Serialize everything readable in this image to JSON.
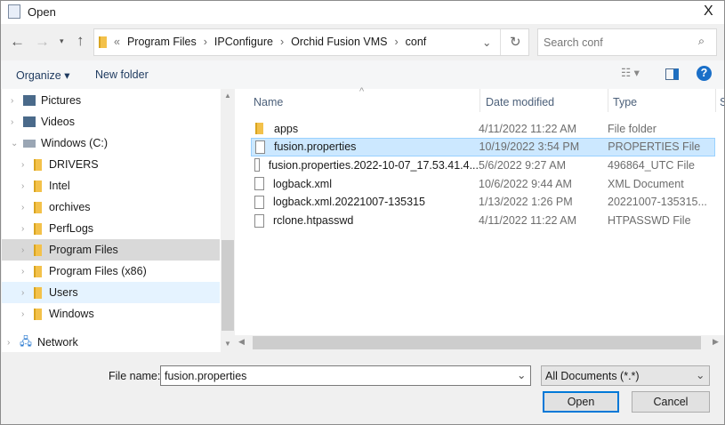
{
  "window": {
    "title": "Open",
    "close": "X"
  },
  "nav": {
    "breadcrumb": [
      "Program Files",
      "IPConfigure",
      "Orchid Fusion VMS",
      "conf"
    ],
    "overflow": "«",
    "search_placeholder": "Search conf"
  },
  "toolbar": {
    "organize": "Organize ▾",
    "new_folder": "New folder",
    "help": "?"
  },
  "sidebar": [
    {
      "label": "Pictures",
      "indent": 1
    },
    {
      "label": "Videos",
      "indent": 1
    },
    {
      "label": "Windows (C:)",
      "indent": 1,
      "expanded": true
    },
    {
      "label": "DRIVERS",
      "indent": 2
    },
    {
      "label": "Intel",
      "indent": 2
    },
    {
      "label": "orchives",
      "indent": 2
    },
    {
      "label": "PerfLogs",
      "indent": 2
    },
    {
      "label": "Program Files",
      "indent": 2,
      "selected": true
    },
    {
      "label": "Program Files (x86)",
      "indent": 2
    },
    {
      "label": "Users",
      "indent": 2,
      "hover": true
    },
    {
      "label": "Windows",
      "indent": 2
    },
    {
      "label": "Network",
      "indent": 0
    }
  ],
  "columns": [
    "Name",
    "Date modified",
    "Type",
    "Size"
  ],
  "files": [
    {
      "name": "apps",
      "date": "4/11/2022 11:22 AM",
      "type": "File folder",
      "folder": true
    },
    {
      "name": "fusion.properties",
      "date": "10/19/2022 3:54 PM",
      "type": "PROPERTIES File",
      "selected": true
    },
    {
      "name": "fusion.properties.2022-10-07_17.53.41.4...",
      "date": "5/6/2022 9:27 AM",
      "type": "496864_UTC File"
    },
    {
      "name": "logback.xml",
      "date": "10/6/2022 9:44 AM",
      "type": "XML Document"
    },
    {
      "name": "logback.xml.20221007-135315",
      "date": "1/13/2022 1:26 PM",
      "type": "20221007-135315..."
    },
    {
      "name": "rclone.htpasswd",
      "date": "4/11/2022 11:22 AM",
      "type": "HTPASSWD File"
    }
  ],
  "footer": {
    "file_name_label": "File name:",
    "file_name_value": "fusion.properties",
    "filter": "All Documents (*.*)",
    "open": "Open",
    "cancel": "Cancel"
  }
}
